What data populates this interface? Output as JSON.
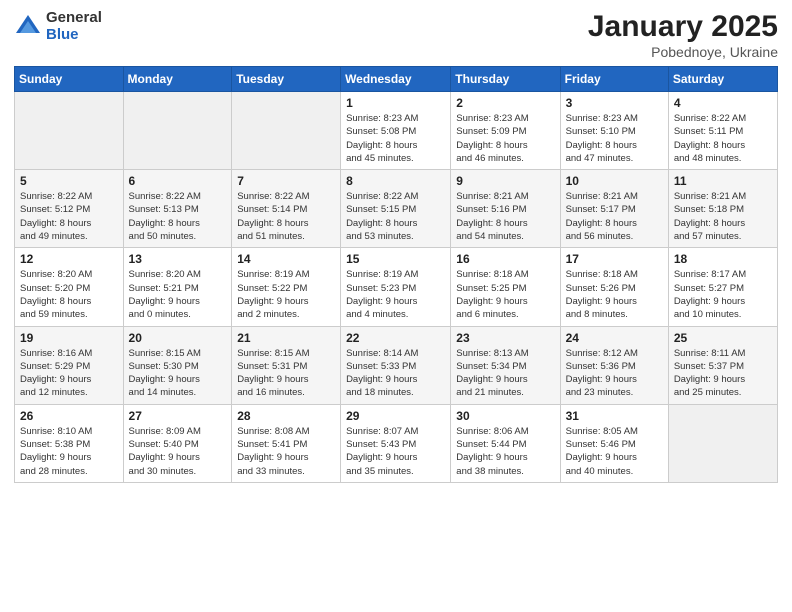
{
  "logo": {
    "general": "General",
    "blue": "Blue"
  },
  "title": "January 2025",
  "subtitle": "Pobednoye, Ukraine",
  "weekdays": [
    "Sunday",
    "Monday",
    "Tuesday",
    "Wednesday",
    "Thursday",
    "Friday",
    "Saturday"
  ],
  "weeks": [
    [
      {
        "day": "",
        "info": ""
      },
      {
        "day": "",
        "info": ""
      },
      {
        "day": "",
        "info": ""
      },
      {
        "day": "1",
        "info": "Sunrise: 8:23 AM\nSunset: 5:08 PM\nDaylight: 8 hours\nand 45 minutes."
      },
      {
        "day": "2",
        "info": "Sunrise: 8:23 AM\nSunset: 5:09 PM\nDaylight: 8 hours\nand 46 minutes."
      },
      {
        "day": "3",
        "info": "Sunrise: 8:23 AM\nSunset: 5:10 PM\nDaylight: 8 hours\nand 47 minutes."
      },
      {
        "day": "4",
        "info": "Sunrise: 8:22 AM\nSunset: 5:11 PM\nDaylight: 8 hours\nand 48 minutes."
      }
    ],
    [
      {
        "day": "5",
        "info": "Sunrise: 8:22 AM\nSunset: 5:12 PM\nDaylight: 8 hours\nand 49 minutes."
      },
      {
        "day": "6",
        "info": "Sunrise: 8:22 AM\nSunset: 5:13 PM\nDaylight: 8 hours\nand 50 minutes."
      },
      {
        "day": "7",
        "info": "Sunrise: 8:22 AM\nSunset: 5:14 PM\nDaylight: 8 hours\nand 51 minutes."
      },
      {
        "day": "8",
        "info": "Sunrise: 8:22 AM\nSunset: 5:15 PM\nDaylight: 8 hours\nand 53 minutes."
      },
      {
        "day": "9",
        "info": "Sunrise: 8:21 AM\nSunset: 5:16 PM\nDaylight: 8 hours\nand 54 minutes."
      },
      {
        "day": "10",
        "info": "Sunrise: 8:21 AM\nSunset: 5:17 PM\nDaylight: 8 hours\nand 56 minutes."
      },
      {
        "day": "11",
        "info": "Sunrise: 8:21 AM\nSunset: 5:18 PM\nDaylight: 8 hours\nand 57 minutes."
      }
    ],
    [
      {
        "day": "12",
        "info": "Sunrise: 8:20 AM\nSunset: 5:20 PM\nDaylight: 8 hours\nand 59 minutes."
      },
      {
        "day": "13",
        "info": "Sunrise: 8:20 AM\nSunset: 5:21 PM\nDaylight: 9 hours\nand 0 minutes."
      },
      {
        "day": "14",
        "info": "Sunrise: 8:19 AM\nSunset: 5:22 PM\nDaylight: 9 hours\nand 2 minutes."
      },
      {
        "day": "15",
        "info": "Sunrise: 8:19 AM\nSunset: 5:23 PM\nDaylight: 9 hours\nand 4 minutes."
      },
      {
        "day": "16",
        "info": "Sunrise: 8:18 AM\nSunset: 5:25 PM\nDaylight: 9 hours\nand 6 minutes."
      },
      {
        "day": "17",
        "info": "Sunrise: 8:18 AM\nSunset: 5:26 PM\nDaylight: 9 hours\nand 8 minutes."
      },
      {
        "day": "18",
        "info": "Sunrise: 8:17 AM\nSunset: 5:27 PM\nDaylight: 9 hours\nand 10 minutes."
      }
    ],
    [
      {
        "day": "19",
        "info": "Sunrise: 8:16 AM\nSunset: 5:29 PM\nDaylight: 9 hours\nand 12 minutes."
      },
      {
        "day": "20",
        "info": "Sunrise: 8:15 AM\nSunset: 5:30 PM\nDaylight: 9 hours\nand 14 minutes."
      },
      {
        "day": "21",
        "info": "Sunrise: 8:15 AM\nSunset: 5:31 PM\nDaylight: 9 hours\nand 16 minutes."
      },
      {
        "day": "22",
        "info": "Sunrise: 8:14 AM\nSunset: 5:33 PM\nDaylight: 9 hours\nand 18 minutes."
      },
      {
        "day": "23",
        "info": "Sunrise: 8:13 AM\nSunset: 5:34 PM\nDaylight: 9 hours\nand 21 minutes."
      },
      {
        "day": "24",
        "info": "Sunrise: 8:12 AM\nSunset: 5:36 PM\nDaylight: 9 hours\nand 23 minutes."
      },
      {
        "day": "25",
        "info": "Sunrise: 8:11 AM\nSunset: 5:37 PM\nDaylight: 9 hours\nand 25 minutes."
      }
    ],
    [
      {
        "day": "26",
        "info": "Sunrise: 8:10 AM\nSunset: 5:38 PM\nDaylight: 9 hours\nand 28 minutes."
      },
      {
        "day": "27",
        "info": "Sunrise: 8:09 AM\nSunset: 5:40 PM\nDaylight: 9 hours\nand 30 minutes."
      },
      {
        "day": "28",
        "info": "Sunrise: 8:08 AM\nSunset: 5:41 PM\nDaylight: 9 hours\nand 33 minutes."
      },
      {
        "day": "29",
        "info": "Sunrise: 8:07 AM\nSunset: 5:43 PM\nDaylight: 9 hours\nand 35 minutes."
      },
      {
        "day": "30",
        "info": "Sunrise: 8:06 AM\nSunset: 5:44 PM\nDaylight: 9 hours\nand 38 minutes."
      },
      {
        "day": "31",
        "info": "Sunrise: 8:05 AM\nSunset: 5:46 PM\nDaylight: 9 hours\nand 40 minutes."
      },
      {
        "day": "",
        "info": ""
      }
    ]
  ]
}
